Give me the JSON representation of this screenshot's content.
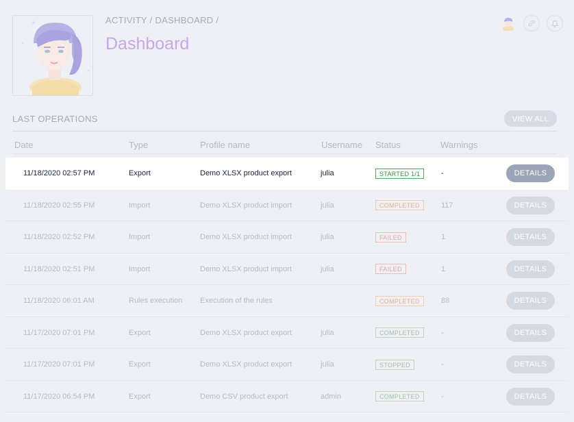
{
  "breadcrumb": "ACTIVITY / DASHBOARD /",
  "page_title": "Dashboard",
  "section_title": "LAST OPERATIONS",
  "view_all_label": "VIEW ALL",
  "columns": {
    "date": "Date",
    "type": "Type",
    "profile": "Profile name",
    "username": "Username",
    "status": "Status",
    "warnings": "Warnings"
  },
  "details_label": "DETAILS",
  "rows": [
    {
      "date": "11/18/2020 02:57 PM",
      "type": "Export",
      "profile": "Demo XLSX product export",
      "username": "julia",
      "status": "STARTED 1/1",
      "warnings": "-"
    },
    {
      "date": "11/18/2020 02:55 PM",
      "type": "Import",
      "profile": "Demo XLSX product import",
      "username": "julia",
      "status": "COMPLETED",
      "warnings": "117"
    },
    {
      "date": "11/18/2020 02:52 PM",
      "type": "Import",
      "profile": "Demo XLSX product import",
      "username": "julia",
      "status": "FAILED",
      "warnings": "1"
    },
    {
      "date": "11/18/2020 02:51 PM",
      "type": "Import",
      "profile": "Demo XLSX product import",
      "username": "julia",
      "status": "FAILED",
      "warnings": "1"
    },
    {
      "date": "11/18/2020 06:01 AM",
      "type": "Rules execution",
      "profile": "Execution of the rules",
      "username": "",
      "status": "COMPLETED",
      "warnings": "88"
    },
    {
      "date": "11/17/2020 07:01 PM",
      "type": "Export",
      "profile": "Demo XLSX product export",
      "username": "julia",
      "status": "COMPLETED",
      "warnings": "-"
    },
    {
      "date": "11/17/2020 07:01 PM",
      "type": "Export",
      "profile": "Demo XLSX product export",
      "username": "julia",
      "status": "STOPPED",
      "warnings": "-"
    },
    {
      "date": "11/17/2020 06:54 PM",
      "type": "Export",
      "profile": "Demo CSV product export",
      "username": "admin",
      "status": "COMPLETED",
      "warnings": "-"
    }
  ],
  "icons": {
    "user_avatar": "user-avatar-icon",
    "link": "link-icon",
    "notifications": "bell-icon"
  },
  "colors": {
    "title_accent": "#c8a7e3",
    "status_green": "#3a8542",
    "status_amber": "#e0b48a",
    "status_red": "#e3a39e"
  }
}
